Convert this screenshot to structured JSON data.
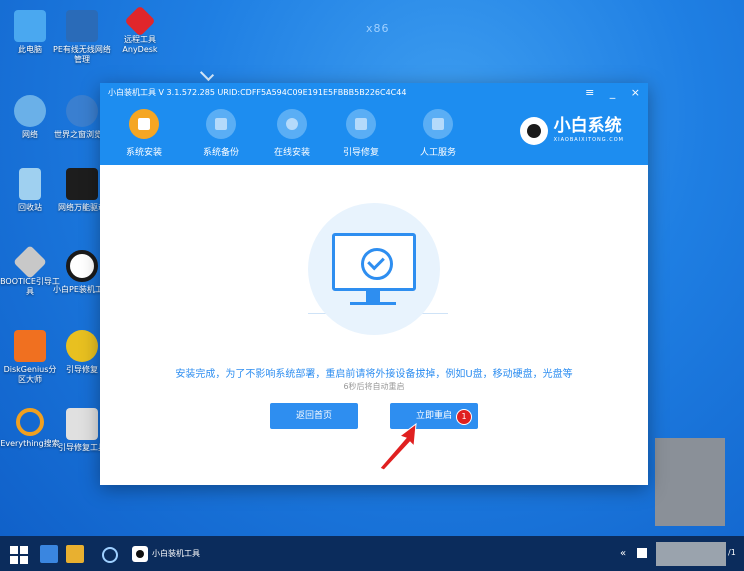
{
  "desktop": {
    "top_label": "x86",
    "icons": [
      {
        "label": "此电脑",
        "color": "#4aa8f0",
        "icon": "computer-icon"
      },
      {
        "label": "PE有线无线网络管理",
        "color": "#2a6bb8",
        "icon": "network-manager-icon"
      },
      {
        "label": "远程工具AnyDesk",
        "color": "#e0262b",
        "icon": "anydesk-icon"
      },
      {
        "label": "网络",
        "color": "#6ab0e8",
        "icon": "network-icon"
      },
      {
        "label": "世界之窗浏览器",
        "color": "#3a7fd0",
        "icon": "browser-icon"
      },
      {
        "label": "回收站",
        "color": "#9fd0f0",
        "icon": "recycle-bin-icon"
      },
      {
        "label": "网络万能驱动",
        "color": "#1d1d1d",
        "icon": "driver-icon"
      },
      {
        "label": "BOOTICE引导工具",
        "color": "#c8c8c8",
        "icon": "bootice-icon"
      },
      {
        "label": "小白PE装机工具",
        "color": "#1a1a1a",
        "icon": "xiaobai-icon"
      },
      {
        "label": "DiskGenius分区大师",
        "color": "#f07020",
        "icon": "diskgenius-icon"
      },
      {
        "label": "引导修复",
        "color": "#e8c020",
        "icon": "boot-repair-icon"
      },
      {
        "label": "Everything搜索",
        "color": "#f0a020",
        "icon": "everything-icon"
      },
      {
        "label": "引导修复工具",
        "color": "#e0e0e0",
        "icon": "boot-repair-tool-icon"
      }
    ]
  },
  "window": {
    "title": "小白装机工具 V 3.1.572.285 URID:CDFF5A594C09E191E5FBBB5B226C4C44",
    "controls": {
      "menu": "≡",
      "minimize": "_",
      "close": "×"
    },
    "tabs": [
      {
        "label": "系统安装",
        "icon": "system-install-icon"
      },
      {
        "label": "系统备份",
        "icon": "system-backup-icon"
      },
      {
        "label": "在线安装",
        "icon": "online-install-icon"
      },
      {
        "label": "引导修复",
        "icon": "boot-repair-icon"
      },
      {
        "label": "人工服务",
        "icon": "support-chat-icon"
      }
    ],
    "brand": {
      "name": "小白系统",
      "url_text": "XIAOBAIXITONG.COM"
    },
    "message": "安装完成，为了不影响系统部署，重启前请将外接设备拔掉，例如U盘，移动硬盘，光盘等",
    "countdown": "6秒后将自动重启",
    "back_button": "返回首页",
    "restart_button": "立即重启",
    "badge": "1"
  },
  "taskbar": {
    "app_label": "小白装机工具",
    "tray_arrow": "«",
    "clock_tail": "/1"
  },
  "colors": {
    "accent": "#2e8ef0",
    "titlebar": "#1d8df0",
    "active_tab": "#f5a623",
    "badge": "#e02020",
    "taskbar": "#0b2c5c"
  }
}
